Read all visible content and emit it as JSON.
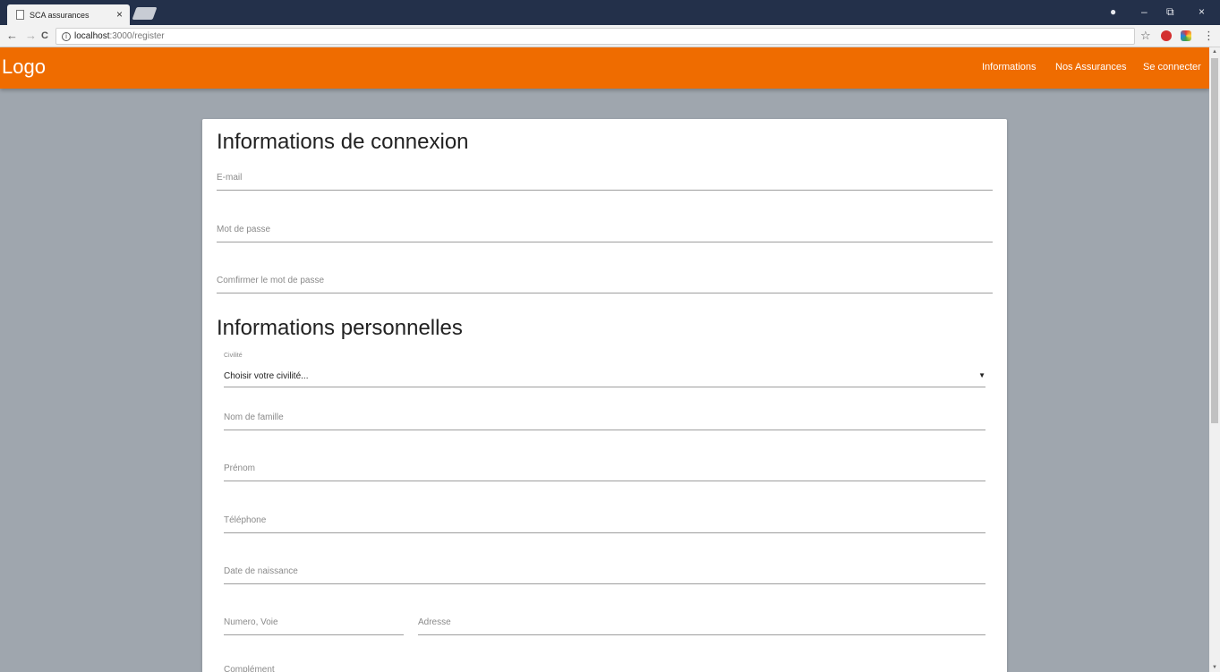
{
  "browser": {
    "tab_title": "SCA assurances",
    "tab_close": "×",
    "url_host": "localhost",
    "url_path": ":3000/register",
    "back": "←",
    "forward": "→",
    "reload": "C",
    "info": "i",
    "star": "☆",
    "account": "●",
    "minimize": "–",
    "restore": "⧉",
    "close": "×",
    "menu": "⋮"
  },
  "header": {
    "logo": "Logo",
    "nav": [
      "Informations",
      "Nos Assurances",
      "Se connecter"
    ]
  },
  "form": {
    "section_login": "Informations de connexion",
    "email_placeholder": "E-mail",
    "password_placeholder": "Mot de passe",
    "confirm_placeholder": "Comfirmer le mot de passe",
    "section_personal": "Informations personnelles",
    "civility_label": "Civilité",
    "civility_value": "Choisir votre civilité...",
    "lastname_placeholder": "Nom de famille",
    "firstname_placeholder": "Prénom",
    "phone_placeholder": "Téléphone",
    "birthdate_placeholder": "Date de naissance",
    "street_number_placeholder": "Numero, Voie",
    "address_placeholder": "Adresse",
    "complement_placeholder": "Complément"
  },
  "colors": {
    "header": "#ef6c00",
    "background": "#9fa6ae",
    "titlebar": "#23304a"
  }
}
